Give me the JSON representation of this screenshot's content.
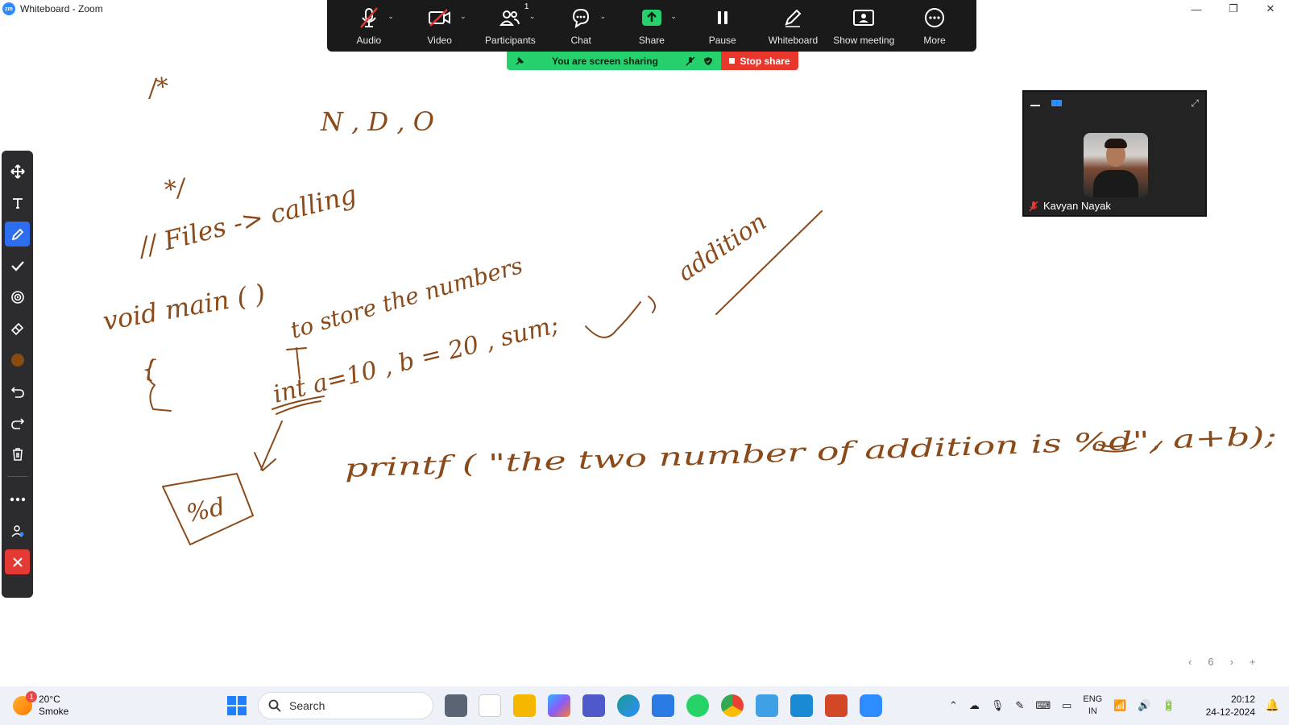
{
  "window": {
    "title": "Whiteboard - Zoom",
    "logo": "zm",
    "controls": {
      "minimize": "—",
      "restore": "❐",
      "close": "✕"
    }
  },
  "meeting_toolbar": {
    "items": [
      {
        "label": "Audio",
        "icon": "microphone-muted-icon",
        "caret": "⌄"
      },
      {
        "label": "Video",
        "icon": "video-off-icon",
        "caret": "⌄"
      },
      {
        "label": "Participants",
        "icon": "participants-icon",
        "badge": "1",
        "caret": "⌄"
      },
      {
        "label": "Chat",
        "icon": "chat-icon",
        "caret": "⌄"
      },
      {
        "label": "Share",
        "icon": "share-screen-icon",
        "caret": "⌄"
      },
      {
        "label": "Pause",
        "icon": "pause-icon"
      },
      {
        "label": "Whiteboard",
        "icon": "pencil-icon"
      },
      {
        "label": "Show meeting",
        "icon": "show-meeting-icon"
      },
      {
        "label": "More",
        "icon": "more-icon"
      }
    ]
  },
  "share_banner": {
    "status": "You are screen sharing",
    "stop_label": "Stop share",
    "colors": {
      "green": "#26d06d",
      "red": "#e8372d"
    }
  },
  "whiteboard_tools": [
    {
      "name": "move-tool",
      "icon": "move-icon"
    },
    {
      "name": "text-tool",
      "icon": "text-icon"
    },
    {
      "name": "pen-tool",
      "icon": "pencil-icon",
      "active": true
    },
    {
      "name": "stamp-tool",
      "icon": "checkmark-icon"
    },
    {
      "name": "spotlight-tool",
      "icon": "spotlight-icon"
    },
    {
      "name": "eraser-tool",
      "icon": "eraser-icon"
    },
    {
      "name": "color-tool",
      "icon": "color-swatch-icon",
      "color": "#8a4b12"
    },
    {
      "name": "undo-tool",
      "icon": "undo-icon"
    },
    {
      "name": "redo-tool",
      "icon": "redo-icon"
    },
    {
      "name": "clear-tool",
      "icon": "trash-icon"
    },
    {
      "name": "more-tool",
      "icon": "more-dots-icon"
    },
    {
      "name": "annotator-name-tool",
      "icon": "person-icon"
    },
    {
      "name": "close-annotation-tool",
      "icon": "close-icon"
    }
  ],
  "video_panel": {
    "participant_name": "Kavyan Nayak",
    "mic": "muted"
  },
  "whiteboard": {
    "ink_color": "#8b4a1a",
    "handwriting": [
      "/*",
      "N , D , O",
      "*/",
      "// Files -> calling",
      "void main ( )",
      "{",
      "to store the numbers",
      "int a=10 , b = 20 , sum;",
      "addition",
      "printf ( \"the two number of addition is %d\", a+b);",
      "%d"
    ]
  },
  "pager": {
    "prev": "‹",
    "page": "6",
    "next": "›",
    "add": "+"
  },
  "taskbar": {
    "weather": {
      "temp": "20°C",
      "condition": "Smoke",
      "badge": "1"
    },
    "search_placeholder": "Search",
    "apps": [
      {
        "name": "task-view",
        "color": "#5b6472"
      },
      {
        "name": "amazon",
        "color": "#ffffff"
      },
      {
        "name": "file-explorer",
        "color": "#f5b700"
      },
      {
        "name": "copilot",
        "color": "#8a5cf6"
      },
      {
        "name": "teams",
        "color": "#5059c9"
      },
      {
        "name": "edge",
        "color": "#1d9b8f"
      },
      {
        "name": "remote-desktop",
        "color": "#2a7be4"
      },
      {
        "name": "whatsapp",
        "color": "#25d366"
      },
      {
        "name": "chrome",
        "color": "#e94235"
      },
      {
        "name": "notepad",
        "color": "#3fa0e6"
      },
      {
        "name": "vscode",
        "color": "#1a8ad4"
      },
      {
        "name": "powerpoint",
        "color": "#d24726"
      },
      {
        "name": "zoom",
        "color": "#2d8cff"
      }
    ],
    "language": {
      "line1": "ENG",
      "line2": "IN"
    },
    "time": "20:12",
    "date": "24-12-2024"
  }
}
